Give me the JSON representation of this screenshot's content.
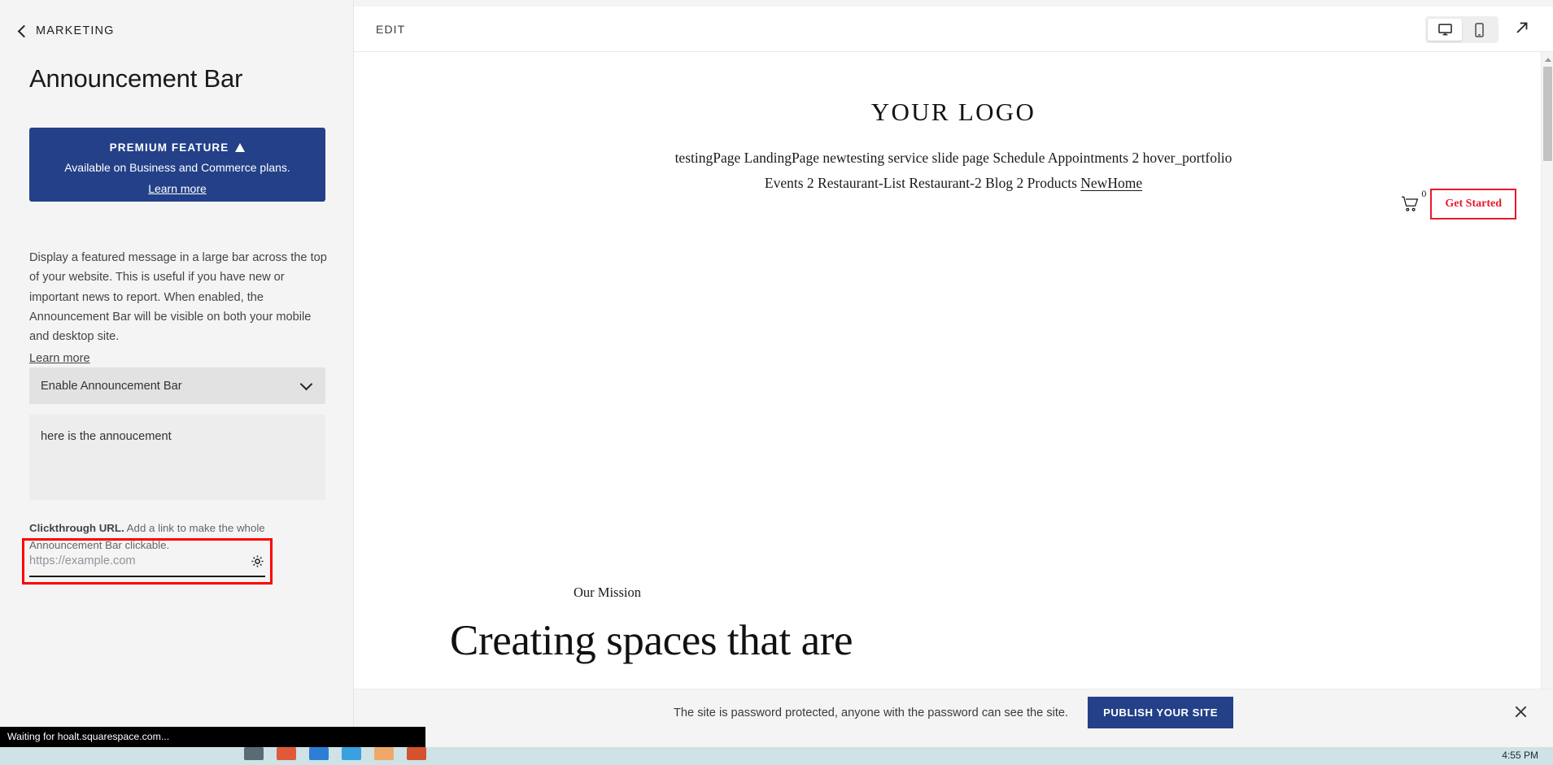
{
  "sidebar": {
    "back_label": "MARKETING",
    "page_title": "Announcement Bar",
    "premium": {
      "heading": "PREMIUM FEATURE",
      "subtext": "Available on Business and Commerce plans.",
      "link": "Learn more",
      "bg_color": "#234088"
    },
    "description": "Display a featured message in a large bar across the top of your website. This is useful if you have new or important news to report. When enabled, the Announcement Bar will be visible on both your mobile and desktop site.",
    "description_link": "Learn more",
    "enable_select": {
      "label": "Enable Announcement Bar"
    },
    "message_value": "here is the annoucement",
    "url_help_bold": "Clickthrough URL.",
    "url_help_rest": " Add a link to make the whole Announcement Bar clickable.",
    "url_placeholder": "https://example.com",
    "url_value": "",
    "highlight_color": "#ff0000"
  },
  "toolbar": {
    "edit_label": "EDIT",
    "desktop_tooltip": "Desktop",
    "mobile_tooltip": "Mobile",
    "open_tooltip": "Open in new tab"
  },
  "site": {
    "logo": "YOUR LOGO",
    "nav_row1": [
      "testingPage",
      "LandingPage",
      "newtesting",
      "service",
      "slide page",
      "Schedule",
      "Appointments 2",
      "hover_portfolio"
    ],
    "nav_row2": [
      "Events 2",
      "Restaurant-List",
      "Restaurant-2",
      "Blog 2",
      "Products"
    ],
    "nav_active": "NewHome",
    "cart_count": "0",
    "cta_label": "Get Started",
    "cta_color": "#e8192c",
    "mission_eyebrow": "Our Mission",
    "mission_heading": "Creating spaces that are"
  },
  "notice": {
    "text": "The site is password protected, anyone with the password can see the site.",
    "publish_label": "PUBLISH YOUR SITE",
    "publish_color": "#234088"
  },
  "browser": {
    "status_text": "Waiting for hoalt.squarespace.com...",
    "clock": "4:55 PM"
  }
}
